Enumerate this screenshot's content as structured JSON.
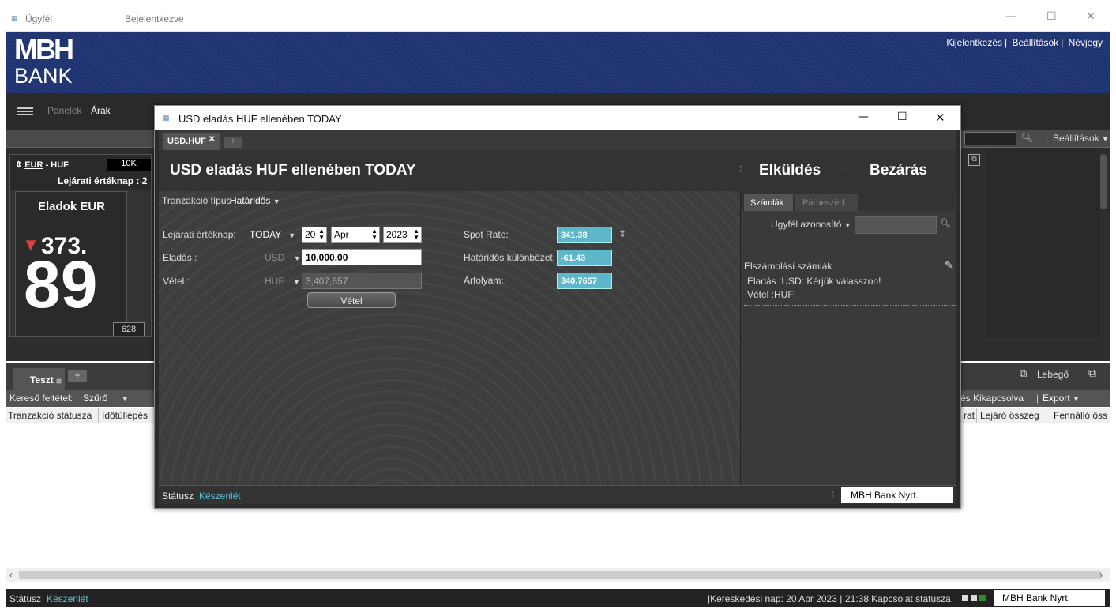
{
  "window": {
    "title": "Ügyfél",
    "status": "Bejelentkezve",
    "minimize": "—",
    "maximize": "☐",
    "close": "✕"
  },
  "banner": {
    "logo_top": "MBH",
    "logo_bottom": "BANK",
    "links": [
      "Kijelentkezés",
      "Beállítások",
      "Névjegy"
    ]
  },
  "menu": {
    "panels": "Panelek",
    "prices": "Árak"
  },
  "toolbar": {
    "settings": "Beállítások"
  },
  "price_panel": {
    "pair_left": "EUR",
    "pair_right": "HUF",
    "amount": "10K",
    "maturity_label": "Lejárati értéknap : 2",
    "side_label": "Eladok EUR",
    "price_small": "373.",
    "price_big": "89",
    "spread": "628"
  },
  "lower": {
    "tab": "Teszt",
    "add": "+",
    "floating": "Lebegő",
    "filter_label": "Kereső feltétel:",
    "filter_value": "Szűrő",
    "switch_label": "és Kikapcsolva",
    "export": "Export",
    "columns": [
      "Tranzakció státusza",
      "Időtúllépés"
    ],
    "columns_right": [
      "rat",
      "Lejáró összeg",
      "Fennálló öss"
    ]
  },
  "statusbar": {
    "label": "Státusz",
    "value": "Készenlét",
    "trading_day": "Kereskedési nap: 20 Apr 2023",
    "time": "21:38",
    "conn_label": "Kapcsolat státusza",
    "brand": "MBH Bank Nyrt."
  },
  "dialog": {
    "title": "USD eladás HUF ellenében TODAY",
    "tab": "USD.HUF",
    "tab_add": "+",
    "heading": "USD eladás HUF ellenében TODAY",
    "send": "Elküldés",
    "close_btn": "Bezárás",
    "trans_type_label": "Tranzakció típus",
    "trans_type_value": "Határidős",
    "maturity_label": "Lejárati értéknap:",
    "maturity_value": "TODAY",
    "day": "20",
    "month": "Apr",
    "year": "2023",
    "sell_label": "Eladás :",
    "sell_ccy": "USD",
    "sell_amount": "10,000.00",
    "buy_label": "Vétel :",
    "buy_ccy": "HUF",
    "buy_amount": "3,407,657",
    "buy_button": "Vétel",
    "spot_label": "Spot Rate:",
    "spot_value": "341.38",
    "fwd_label": "Határidős különbözet:",
    "fwd_value": "-61.43",
    "rate_label": "Árfolyam:",
    "rate_value": "340.7657",
    "right_tabs": [
      "Számlák",
      "Párbeszéd"
    ],
    "client_id_label": "Ügyfél azonosító",
    "accounts_title": "Elszámolási számlák",
    "acc_sell": "Eladás :USD: Kérjük válasszon!",
    "acc_buy": "Vétel :HUF:",
    "status_label": "Státusz",
    "status_value": "Készenlét",
    "brand": "MBH Bank Nyrt."
  }
}
